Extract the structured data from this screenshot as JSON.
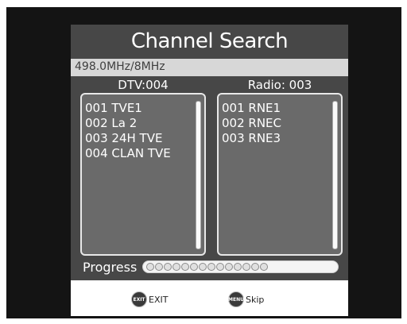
{
  "osd": {
    "title": "Channel Search",
    "frequency": "498.0MHz/8MHz",
    "tv": {
      "header": "DTV:004",
      "channels": [
        "001 TVE1",
        "002 La 2",
        "003 24H TVE",
        "004 CLAN TVE"
      ]
    },
    "radio": {
      "header": "Radio: 003",
      "channels": [
        "001 RNE1",
        "002 RNEC",
        "003 RNE3"
      ]
    },
    "progress": {
      "label": "Progress",
      "value_fraction": 0.52
    },
    "buttons": {
      "exit": {
        "icon_text": "EXIT",
        "label": "EXIT",
        "icon": "exit-remote-key-icon"
      },
      "skip": {
        "icon_text": "MENU",
        "label": "Skip",
        "icon": "menu-remote-key-icon"
      }
    }
  },
  "colors": {
    "osd_background": "#474747",
    "panel_background": "#6a6a6a",
    "frequency_bar": "#d7d7d7",
    "text": "#ffffff"
  }
}
